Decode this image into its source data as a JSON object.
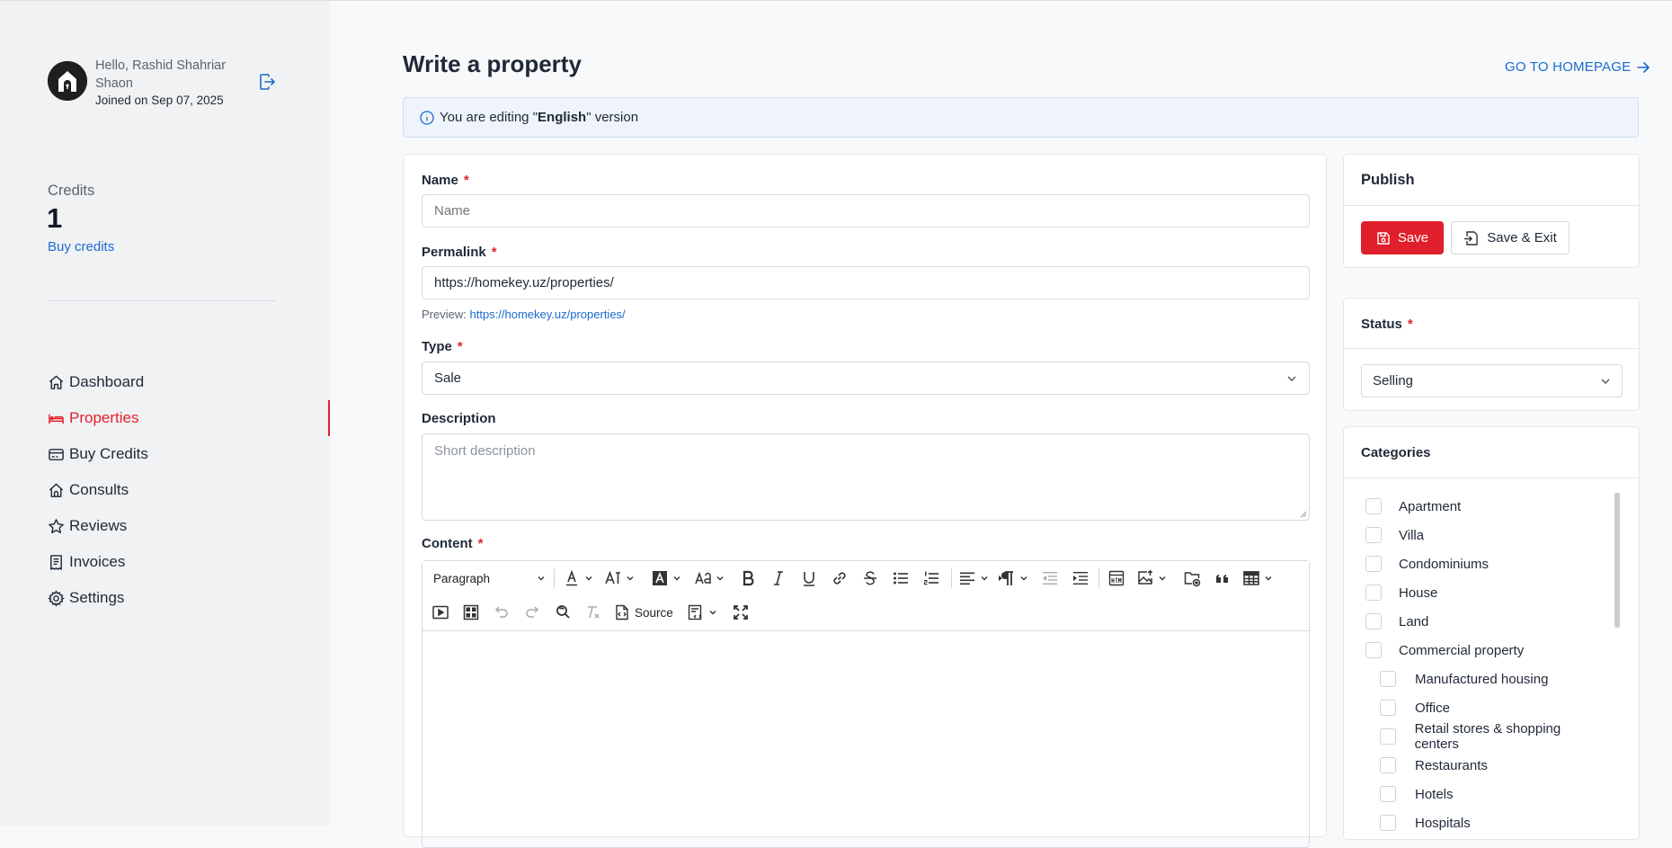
{
  "user": {
    "greeting": "Hello, Rashid Shahriar Shaon",
    "joined": "Joined on Sep 07, 2025"
  },
  "credits": {
    "label": "Credits",
    "value": "1",
    "buy_link": "Buy credits"
  },
  "nav": [
    {
      "label": "Dashboard",
      "icon": "home-icon"
    },
    {
      "label": "Properties",
      "icon": "bed-icon",
      "active": true
    },
    {
      "label": "Buy Credits",
      "icon": "credit-card-icon"
    },
    {
      "label": "Consults",
      "icon": "home-outline-icon"
    },
    {
      "label": "Reviews",
      "icon": "star-icon"
    },
    {
      "label": "Invoices",
      "icon": "receipt-icon"
    },
    {
      "label": "Settings",
      "icon": "gear-icon"
    }
  ],
  "header": {
    "title": "Write a property",
    "go_home": "GO TO HOMEPAGE"
  },
  "alert": {
    "prefix": "You are editing \"",
    "language": "English",
    "suffix": "\" version"
  },
  "form": {
    "name": {
      "label": "Name",
      "placeholder": "Name",
      "value": ""
    },
    "permalink": {
      "label": "Permalink",
      "value": "https://homekey.uz/properties/",
      "preview_label": "Preview:",
      "preview_url": "https://homekey.uz/properties/"
    },
    "type": {
      "label": "Type",
      "value": "Sale"
    },
    "description": {
      "label": "Description",
      "placeholder": "Short description"
    },
    "content": {
      "label": "Content",
      "heading_select": "Paragraph",
      "source_label": "Source"
    }
  },
  "publish": {
    "title": "Publish",
    "save_label": "Save",
    "save_exit_label": "Save & Exit"
  },
  "status": {
    "title": "Status",
    "value": "Selling"
  },
  "categories": {
    "title": "Categories",
    "items": [
      {
        "label": "Apartment",
        "level": 0
      },
      {
        "label": "Villa",
        "level": 0
      },
      {
        "label": "Condominiums",
        "level": 0
      },
      {
        "label": "House",
        "level": 0
      },
      {
        "label": "Land",
        "level": 0
      },
      {
        "label": "Commercial property",
        "level": 0
      },
      {
        "label": "Manufactured housing",
        "level": 1
      },
      {
        "label": "Office",
        "level": 1
      },
      {
        "label": "Retail stores & shopping centers",
        "level": 1
      },
      {
        "label": "Restaurants",
        "level": 1
      },
      {
        "label": "Hotels",
        "level": 1
      },
      {
        "label": "Hospitals",
        "level": 1
      }
    ]
  },
  "colors": {
    "accent": "#df1f2b",
    "link": "#1a6bd0",
    "sidebar_bg": "#f1f2f4",
    "alert_bg": "#eef4fa"
  }
}
